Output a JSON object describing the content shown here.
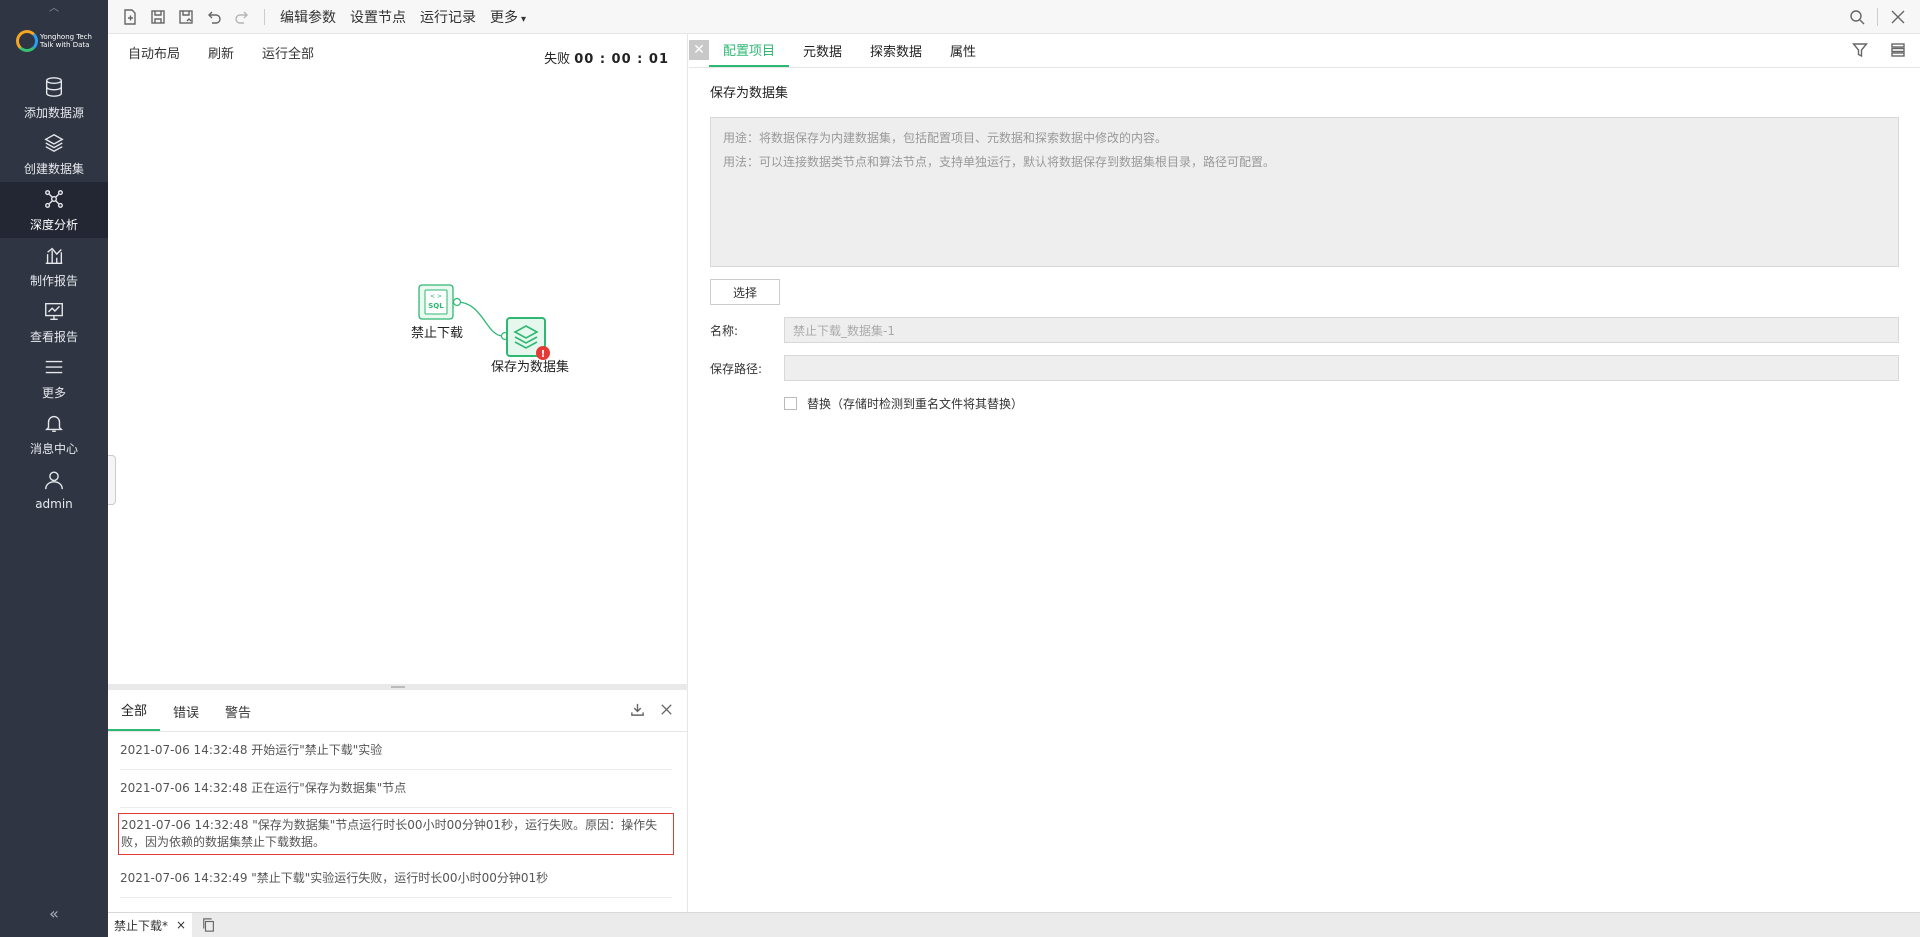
{
  "sidebar": {
    "logo_text": [
      "Yonghong Tech",
      "Talk with Data"
    ],
    "items": [
      {
        "label": "添加数据源",
        "icon": "database-icon"
      },
      {
        "label": "创建数据集",
        "icon": "layers-icon"
      },
      {
        "label": "深度分析",
        "icon": "network-icon"
      },
      {
        "label": "制作报告",
        "icon": "chart-icon"
      },
      {
        "label": "查看报告",
        "icon": "monitor-icon"
      },
      {
        "label": "更多",
        "icon": "menu-icon"
      },
      {
        "label": "消息中心",
        "icon": "bell-icon"
      },
      {
        "label": "admin",
        "icon": "user-icon"
      }
    ],
    "active": "深度分析",
    "collapse": "«"
  },
  "toolbar": {
    "edit_params": "编辑参数",
    "set_node": "设置节点",
    "run_log": "运行记录",
    "more": "更多"
  },
  "canvas_toolbar": {
    "auto_layout": "自动布局",
    "refresh": "刷新",
    "run_all": "运行全部",
    "status_label": "失败",
    "status_time": "00 : 00 : 01"
  },
  "nodes": {
    "source": {
      "label": "禁止下载"
    },
    "target": {
      "label": "保存为数据集"
    }
  },
  "log": {
    "tabs": [
      "全部",
      "错误",
      "警告"
    ],
    "active_tab": "全部",
    "rows": [
      "2021-07-06 14:32:48 开始运行\"禁止下载\"实验",
      "2021-07-06 14:32:48 正在运行\"保存为数据集\"节点",
      "2021-07-06 14:32:48 \"保存为数据集\"节点运行时长00小时00分钟01秒，运行失败。原因：操作失败，因为依赖的数据集禁止下载数据。",
      "2021-07-06 14:32:49 \"禁止下载\"实验运行失败，运行时长00小时00分钟01秒"
    ]
  },
  "right": {
    "tabs": [
      "配置项目",
      "元数据",
      "探索数据",
      "属性"
    ],
    "active_tab": "配置项目",
    "section_title": "保存为数据集",
    "desc_line1": "用途：将数据保存为内建数据集，包括配置项目、元数据和探索数据中修改的内容。",
    "desc_line2": "用法：可以连接数据类节点和算法节点，支持单独运行，默认将数据保存到数据集根目录，路径可配置。",
    "select_btn": "选择",
    "name_label": "名称:",
    "name_value": "禁止下载_数据集-1",
    "path_label": "保存路径:",
    "path_value": "",
    "replace_label": "替换（存储时检测到重名文件将其替换）"
  },
  "bottom": {
    "tab_label": "禁止下载*",
    "tab_close": "×"
  },
  "colors": {
    "accent": "#2eb872",
    "sidebar_bg": "#2f3542",
    "error_red": "#e53935"
  }
}
